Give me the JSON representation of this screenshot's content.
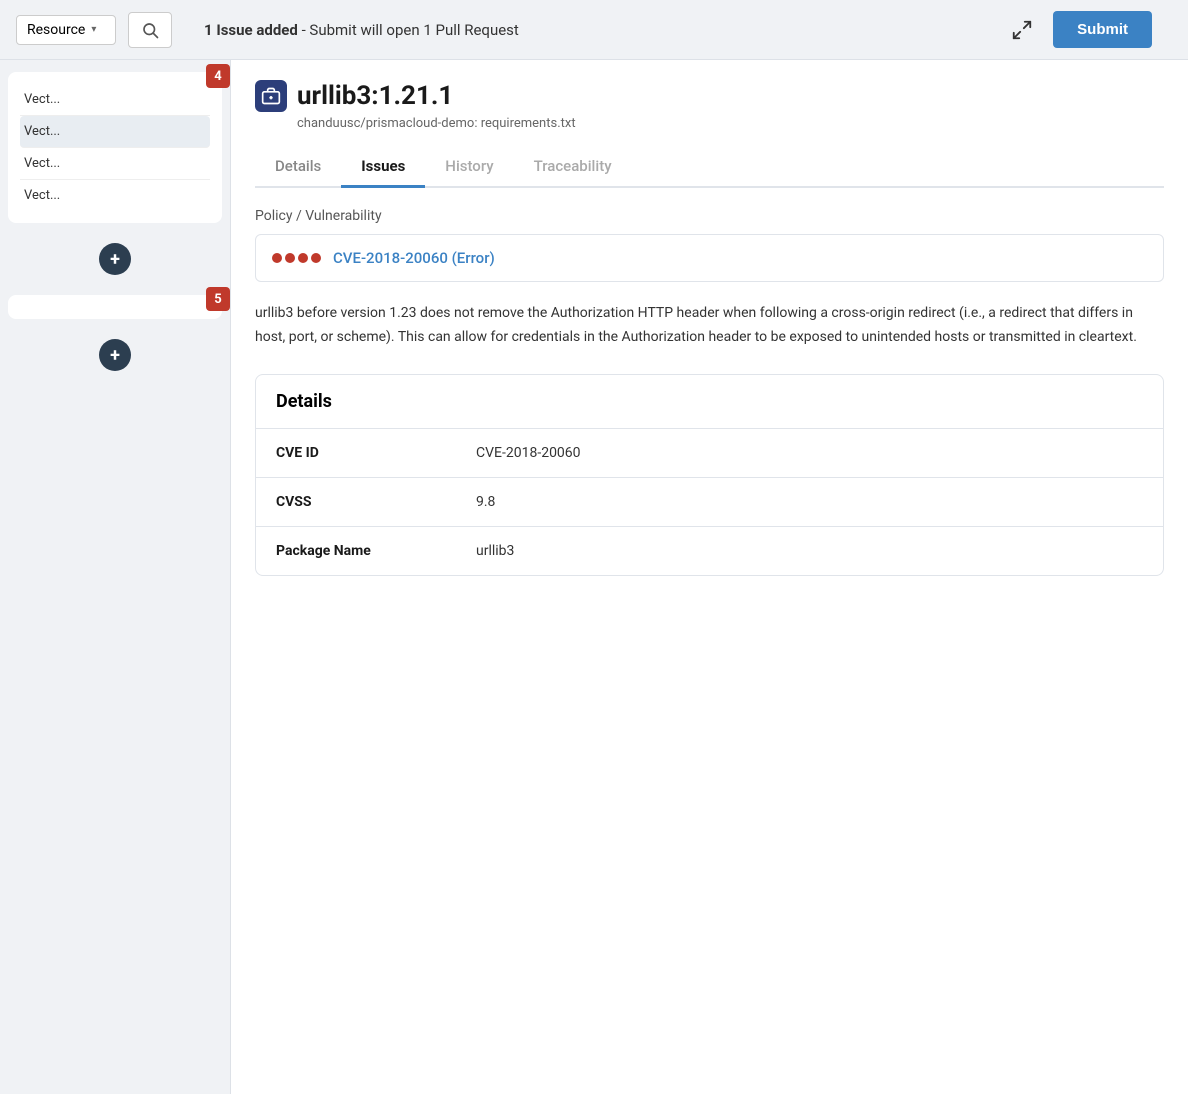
{
  "topbar": {
    "resource_label": "Resource",
    "issue_count_text": "1 Issue added",
    "issue_sub_text": "- Submit will open 1 Pull Request",
    "submit_label": "Submit"
  },
  "sidebar": {
    "cards": [
      {
        "badge": "4",
        "items": [
          "Vect...",
          "Vect...",
          "Vect...",
          "Vect..."
        ],
        "highlighted_index": 1,
        "add_icon": "+"
      },
      {
        "badge": "5",
        "items": [],
        "add_icon": "+"
      }
    ]
  },
  "panel": {
    "package_name": "urllib3:1.21.1",
    "package_path": "chanduusc/prismacloud-demo: requirements.txt",
    "tabs": [
      {
        "label": "Details",
        "active": false
      },
      {
        "label": "Issues",
        "active": true
      },
      {
        "label": "History",
        "active": false
      },
      {
        "label": "Traceability",
        "active": false
      }
    ],
    "section_label": "Policy / Vulnerability",
    "cve": {
      "label": "CVE-2018-20060 (Error)",
      "dots": 4
    },
    "description": "urllib3 before version 1.23 does not remove the Authorization HTTP header when following a cross-origin redirect (i.e., a redirect that differs in host, port, or scheme). This can allow for credentials in the Authorization header to be exposed to unintended hosts or transmitted in cleartext.",
    "details_card": {
      "title": "Details",
      "rows": [
        {
          "label": "CVE ID",
          "value": "CVE-2018-20060"
        },
        {
          "label": "CVSS",
          "value": "9.8"
        },
        {
          "label": "Package Name",
          "value": "urllib3"
        }
      ]
    }
  }
}
